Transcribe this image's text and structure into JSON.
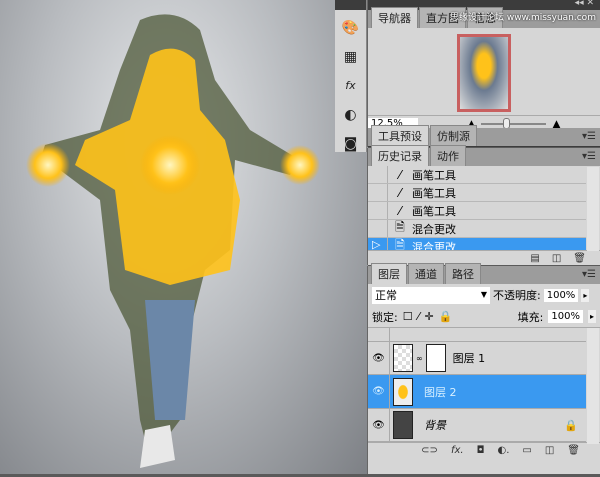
{
  "watermark_top": "思缘设计论坛 www.missyuan.com",
  "strip": {
    "icons": [
      "color-palette-icon",
      "swatches-grid-icon",
      "styles-fx-icon",
      "adjustments-icon",
      "mask-icon"
    ]
  },
  "navigator": {
    "tabs": [
      "导航器",
      "直方图",
      "信息"
    ],
    "zoom": "12.5%"
  },
  "tool_presets": {
    "tabs": [
      "工具预设",
      "仿制源"
    ]
  },
  "history": {
    "tabs": [
      "历史记录",
      "动作"
    ],
    "items": [
      {
        "label": "画笔工具",
        "icon": "brush-icon"
      },
      {
        "label": "画笔工具",
        "icon": "brush-icon"
      },
      {
        "label": "画笔工具",
        "icon": "brush-icon"
      },
      {
        "label": "混合更改",
        "icon": "document-icon"
      },
      {
        "label": "混合更改",
        "icon": "document-icon",
        "selected": true
      }
    ]
  },
  "layers": {
    "tabs": [
      "图层",
      "通道",
      "路径"
    ],
    "blend_mode": "正常",
    "opacity_label": "不透明度:",
    "opacity": "100%",
    "lock_label": "锁定:",
    "fill_label": "填充:",
    "fill": "100%",
    "items": [
      {
        "name": "图层 1"
      },
      {
        "name": "图层 2",
        "selected": true
      },
      {
        "name": "背景",
        "locked": true
      }
    ]
  },
  "colors": {
    "selection": "#3a99f0",
    "glow": "#ffc21a"
  }
}
